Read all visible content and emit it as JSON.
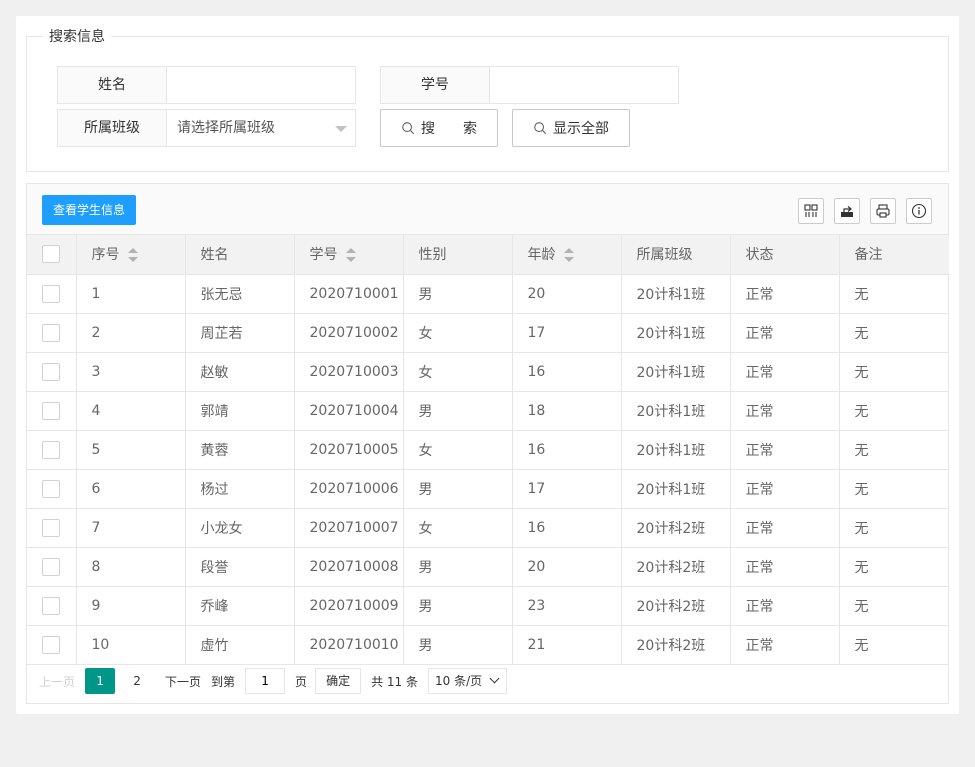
{
  "search": {
    "legend": "搜索信息",
    "name_label": "姓名",
    "name_value": "",
    "student_no_label": "学号",
    "student_no_value": "",
    "class_label": "所属班级",
    "class_placeholder": "请选择所属班级",
    "search_button": "搜　　索",
    "show_all_button": "显示全部"
  },
  "toolbar": {
    "view_button": "查看学生信息",
    "tools": [
      "columns-icon",
      "export-icon",
      "print-icon",
      "info-icon"
    ]
  },
  "table": {
    "headers": [
      "序号",
      "姓名",
      "学号",
      "性别",
      "年龄",
      "所属班级",
      "状态",
      "备注"
    ],
    "rows": [
      [
        "1",
        "张无忌",
        "2020710001",
        "男",
        "20",
        "20计科1班",
        "正常",
        "无"
      ],
      [
        "2",
        "周芷若",
        "2020710002",
        "女",
        "17",
        "20计科1班",
        "正常",
        "无"
      ],
      [
        "3",
        "赵敏",
        "2020710003",
        "女",
        "16",
        "20计科1班",
        "正常",
        "无"
      ],
      [
        "4",
        "郭靖",
        "2020710004",
        "男",
        "18",
        "20计科1班",
        "正常",
        "无"
      ],
      [
        "5",
        "黄蓉",
        "2020710005",
        "女",
        "16",
        "20计科1班",
        "正常",
        "无"
      ],
      [
        "6",
        "杨过",
        "2020710006",
        "男",
        "17",
        "20计科1班",
        "正常",
        "无"
      ],
      [
        "7",
        "小龙女",
        "2020710007",
        "女",
        "16",
        "20计科2班",
        "正常",
        "无"
      ],
      [
        "8",
        "段誉",
        "2020710008",
        "男",
        "20",
        "20计科2班",
        "正常",
        "无"
      ],
      [
        "9",
        "乔峰",
        "2020710009",
        "男",
        "23",
        "20计科2班",
        "正常",
        "无"
      ],
      [
        "10",
        "虚竹",
        "2020710010",
        "男",
        "21",
        "20计科2班",
        "正常",
        "无"
      ]
    ]
  },
  "pager": {
    "prev": "上一页",
    "current": "1",
    "page2": "2",
    "next": "下一页",
    "goto_label": "到第",
    "goto_value": "1",
    "page_unit": "页",
    "confirm": "确定",
    "total": "共 11 条",
    "limit": "10 条/页"
  },
  "colors": {
    "primary_blue": "#1e9fff",
    "pager_active": "#009688"
  }
}
